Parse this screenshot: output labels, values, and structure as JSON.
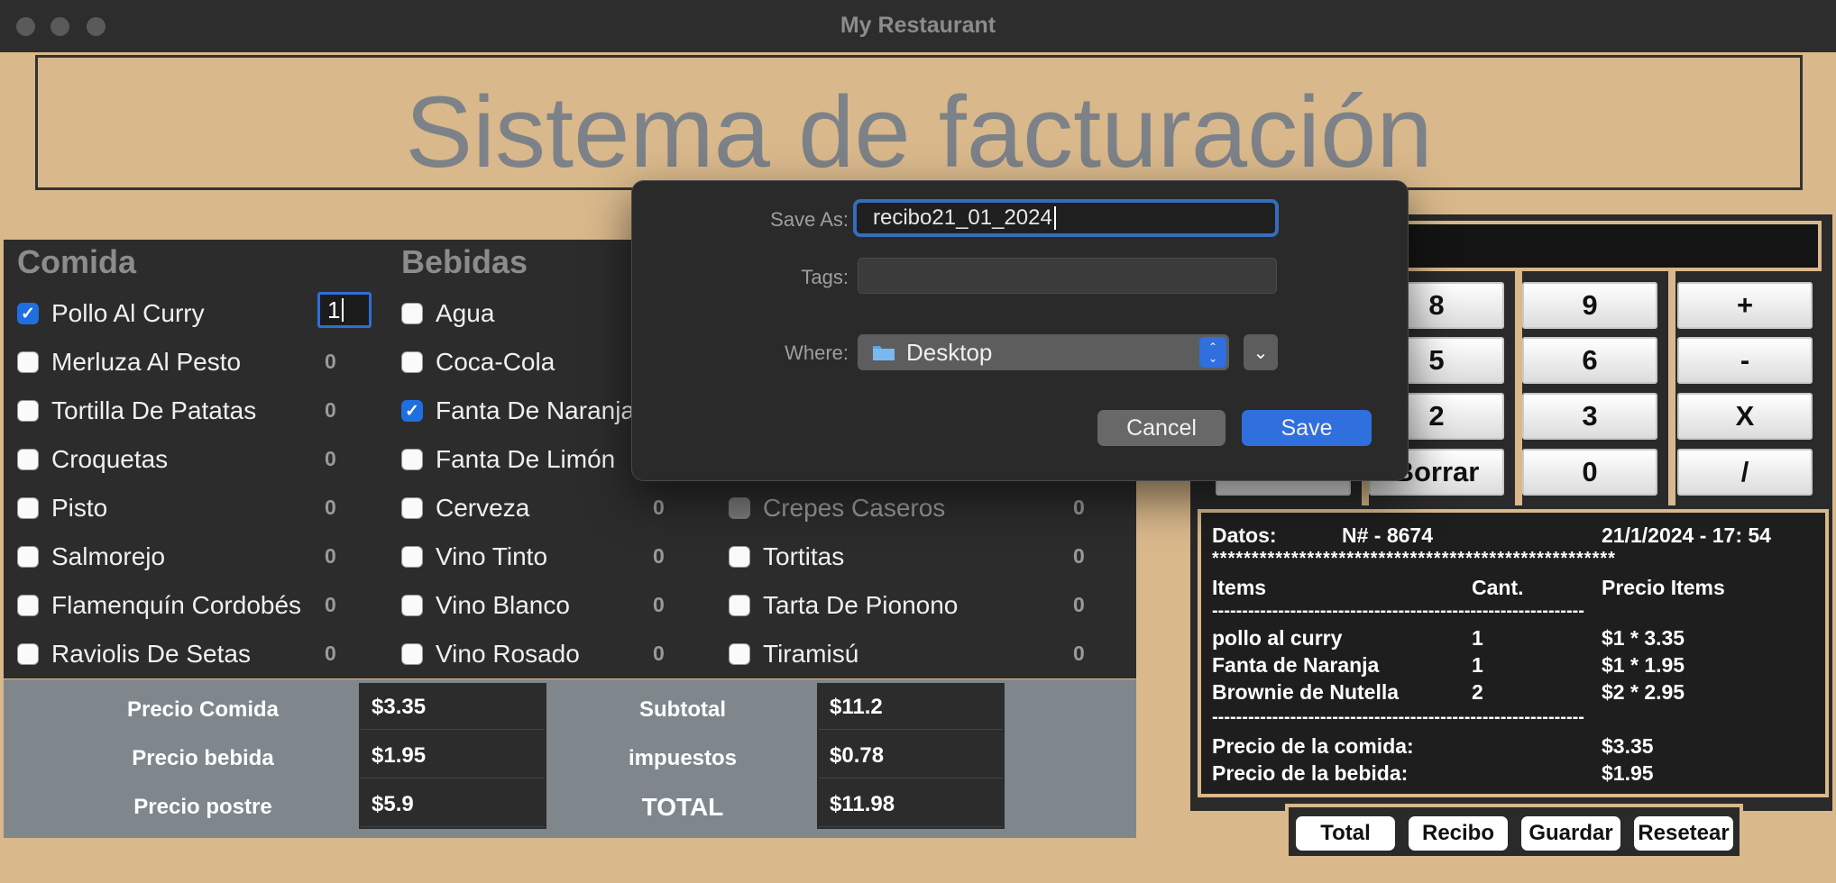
{
  "window": {
    "title": "My Restaurant"
  },
  "banner": {
    "title": "Sistema de facturación"
  },
  "menu": {
    "comida": {
      "heading": "Comida",
      "items": [
        {
          "label": "Pollo Al Curry",
          "checked": true,
          "qty": "1"
        },
        {
          "label": "Merluza Al Pesto",
          "checked": false,
          "qty": "0"
        },
        {
          "label": "Tortilla De Patatas",
          "checked": false,
          "qty": "0"
        },
        {
          "label": "Croquetas",
          "checked": false,
          "qty": "0"
        },
        {
          "label": "Pisto",
          "checked": false,
          "qty": "0"
        },
        {
          "label": "Salmorejo",
          "checked": false,
          "qty": "0"
        },
        {
          "label": "Flamenquín Cordobés",
          "checked": false,
          "qty": "0"
        },
        {
          "label": "Raviolis De Setas",
          "checked": false,
          "qty": "0"
        }
      ]
    },
    "bebidas": {
      "heading": "Bebidas",
      "items": [
        {
          "label": "Agua",
          "checked": false,
          "qty": ""
        },
        {
          "label": "Coca-Cola",
          "checked": false,
          "qty": ""
        },
        {
          "label": "Fanta De Naranja",
          "checked": true,
          "qty": ""
        },
        {
          "label": "Fanta De Limón",
          "checked": false,
          "qty": ""
        },
        {
          "label": "Cerveza",
          "checked": false,
          "qty": "0"
        },
        {
          "label": "Vino Tinto",
          "checked": false,
          "qty": "0"
        },
        {
          "label": "Vino Blanco",
          "checked": false,
          "qty": "0"
        },
        {
          "label": "Vino Rosado",
          "checked": false,
          "qty": "0"
        }
      ]
    },
    "postres": {
      "items": [
        {
          "label": "Crepes Caseros",
          "checked": false,
          "disabled": true,
          "qty": "0"
        },
        {
          "label": "Tortitas",
          "checked": false,
          "qty": "0"
        },
        {
          "label": "Tarta De Pionono",
          "checked": false,
          "qty": "0"
        },
        {
          "label": "Tiramisú",
          "checked": false,
          "qty": "0"
        }
      ]
    }
  },
  "totals": {
    "precio_comida_label": "Precio Comida",
    "precio_comida": "$3.35",
    "precio_bebida_label": "Precio bebida",
    "precio_bebida": "$1.95",
    "precio_postre_label": "Precio postre",
    "precio_postre": "$5.9",
    "subtotal_label": "Subtotal",
    "subtotal": "$11.2",
    "impuestos_label": "impuestos",
    "impuestos": "$0.78",
    "total_label": "TOTAL",
    "total": "$11.98"
  },
  "calculator": {
    "keys": [
      "8",
      "9",
      "+",
      "5",
      "6",
      "-",
      "2",
      "3",
      "X",
      "Borrar",
      "0",
      "/"
    ]
  },
  "receipt": {
    "datos_label": "Datos:",
    "number": "N# - 8674",
    "datetime": "21/1/2024 - 17: 54",
    "stars": "***************************************************",
    "col_items": "Items",
    "col_cant": "Cant.",
    "col_precio": "Precio Items",
    "dashes": "--------------------------------------------------------------",
    "lines": [
      {
        "item": "pollo al curry",
        "cant": "1",
        "precio": "$1 * 3.35"
      },
      {
        "item": "Fanta de Naranja",
        "cant": "1",
        "precio": "$1 * 1.95"
      },
      {
        "item": "Brownie de Nutella",
        "cant": "2",
        "precio": "$2 * 2.95"
      }
    ],
    "precio_comida_label": "Precio de la comida:",
    "precio_comida": "$3.35",
    "precio_bebida_label": "Precio de la bebida:",
    "precio_bebida": "$1.95"
  },
  "actions": {
    "total": "Total",
    "recibo": "Recibo",
    "guardar": "Guardar",
    "resetear": "Resetear"
  },
  "save_dialog": {
    "save_as_label": "Save As:",
    "save_as_value": "recibo21_01_2024",
    "tags_label": "Tags:",
    "tags_value": "",
    "where_label": "Where:",
    "where_value": "Desktop",
    "cancel_label": "Cancel",
    "save_label": "Save",
    "accent": "#2f6fde"
  }
}
